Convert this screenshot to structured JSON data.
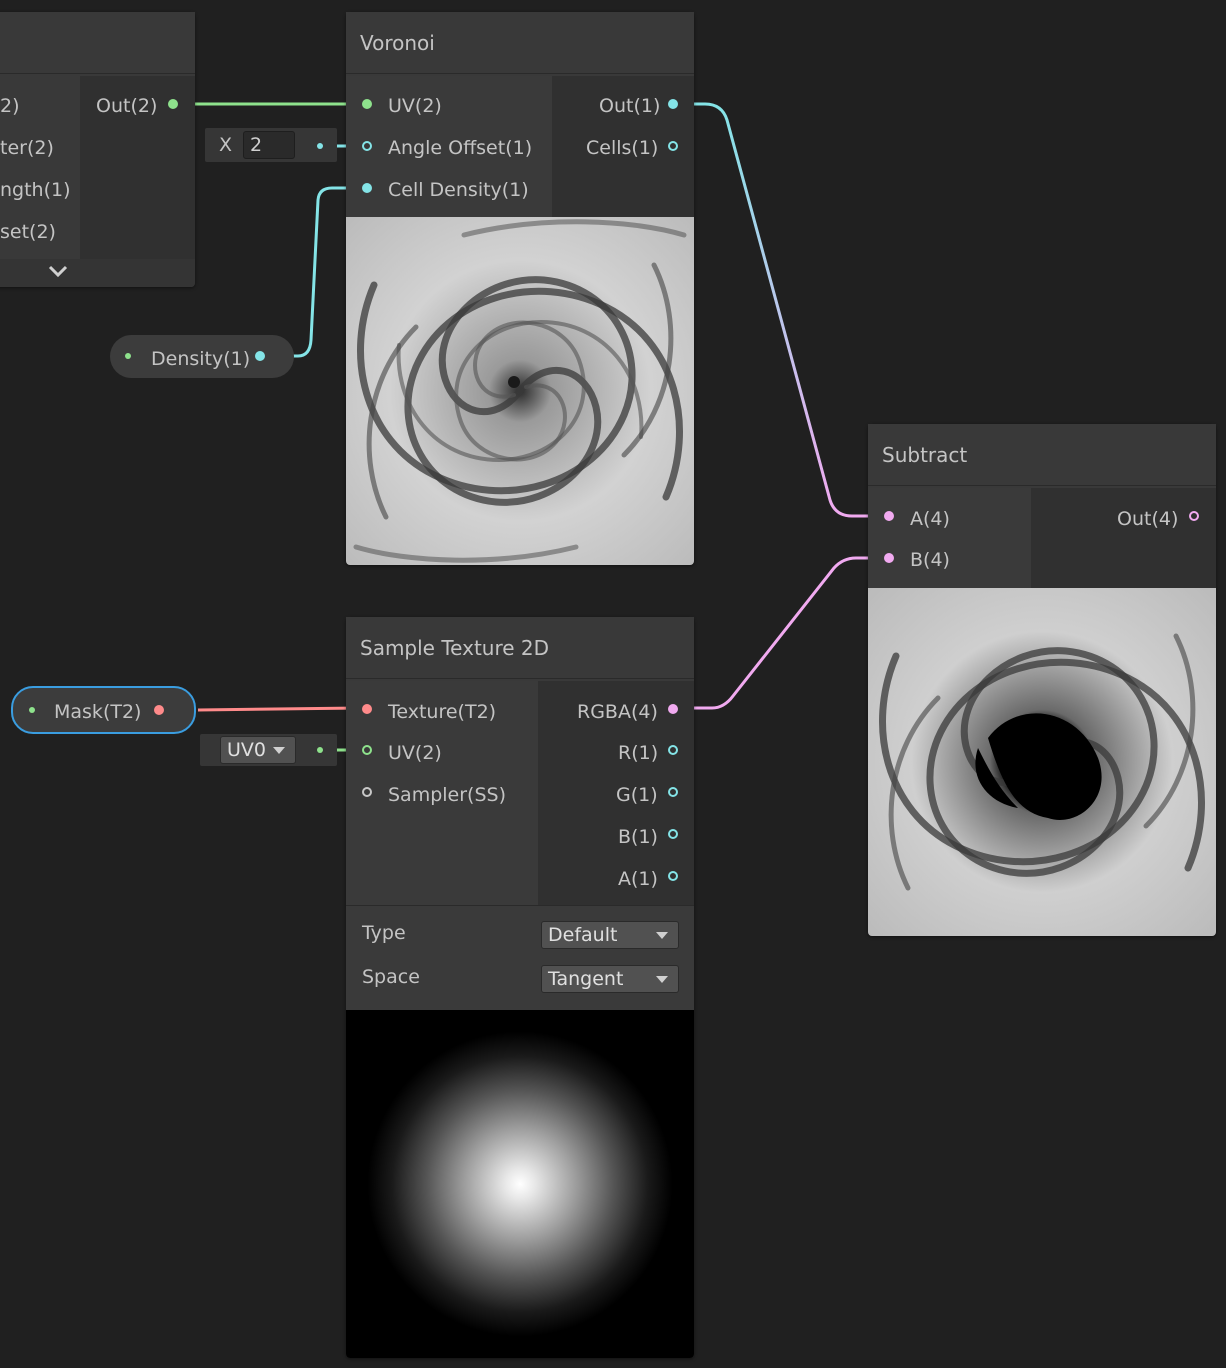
{
  "colors": {
    "vector2": "#8ee28c",
    "vector1": "#84e4e7",
    "vector4": "#f1aaf0",
    "texture": "#ff8b8b",
    "sampler": "#c8c8c8",
    "selection": "#3a9de0"
  },
  "left_node": {
    "inputs": [
      "2)",
      "ter(2)",
      "ngth(1)",
      "set(2)"
    ],
    "output": "Out(2)",
    "expand_icon": "chevron-down-icon"
  },
  "voronoi": {
    "title": "Voronoi",
    "inputs": [
      "UV(2)",
      "Angle Offset(1)",
      "Cell Density(1)"
    ],
    "outputs": [
      "Out(1)",
      "Cells(1)"
    ],
    "angle_offset_axis": "X",
    "angle_offset_value": "2"
  },
  "density_property": {
    "label": "Density(1)"
  },
  "mask_property": {
    "label": "Mask(T2)"
  },
  "sample_texture": {
    "title": "Sample Texture 2D",
    "inputs": [
      "Texture(T2)",
      "UV(2)",
      "Sampler(SS)"
    ],
    "outputs": [
      "RGBA(4)",
      "R(1)",
      "G(1)",
      "B(1)",
      "A(1)"
    ],
    "uv_channel": "UV0",
    "type_label": "Type",
    "type_value": "Default",
    "space_label": "Space",
    "space_value": "Tangent"
  },
  "subtract": {
    "title": "Subtract",
    "inputs": [
      "A(4)",
      "B(4)"
    ],
    "outputs": [
      "Out(4)"
    ]
  }
}
